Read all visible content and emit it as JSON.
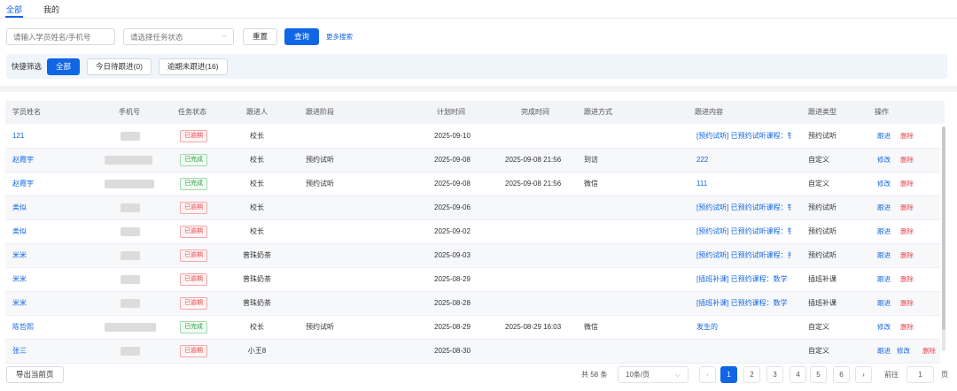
{
  "tabs": {
    "all": "全部",
    "mine": "我的"
  },
  "search": {
    "name_placeholder": "请输入学员姓名/手机号",
    "status_placeholder": "请选择任务状态",
    "reset": "重置",
    "query": "查询",
    "more": "更多搜索"
  },
  "quick": {
    "label": "快捷筛选",
    "all": "全部",
    "today": "今日待跟进(0)",
    "overdue": "逾期未跟进(16)"
  },
  "table": {
    "headers": {
      "name": "学员姓名",
      "phone": "手机号",
      "status": "任务状态",
      "owner": "跟进人",
      "stage": "跟进阶段",
      "plan": "计划时间",
      "finish": "完成时间",
      "method": "跟进方式",
      "content": "跟进内容",
      "type": "跟进类型",
      "ops": "操作"
    },
    "rows": [
      {
        "name": "121",
        "status": "已逾期",
        "owner": "校长",
        "stage": "",
        "plan": "2025-09-10",
        "finish": "",
        "method": "",
        "content": "[预约试听] 已预约试听课程：钅",
        "type": "预约试听",
        "ops": [
          "跟进",
          "删除"
        ]
      },
      {
        "name": "赵霞宇",
        "status": "已完成",
        "owner": "校长",
        "stage": "预约试听",
        "plan": "2025-09-08",
        "finish": "2025-09-08 21:56",
        "method": "到访",
        "content": "222",
        "type": "自定义",
        "ops": [
          "修改",
          "删除"
        ]
      },
      {
        "name": "赵霞宇",
        "status": "已完成",
        "owner": "校长",
        "stage": "预约试听",
        "plan": "2025-09-08",
        "finish": "2025-09-08 21:56",
        "method": "微信",
        "content": "111",
        "type": "自定义",
        "ops": [
          "修改",
          "删除"
        ]
      },
      {
        "name": "类似",
        "status": "已逾期",
        "owner": "校长",
        "stage": "",
        "plan": "2025-09-06",
        "finish": "",
        "method": "",
        "content": "[预约试听] 已预约试听课程：钅",
        "type": "预约试听",
        "ops": [
          "跟进",
          "删除"
        ]
      },
      {
        "name": "类似",
        "status": "已逾期",
        "owner": "校长",
        "stage": "",
        "plan": "2025-09-02",
        "finish": "",
        "method": "",
        "content": "[预约试听] 已预约试听课程：钅",
        "type": "预约试听",
        "ops": [
          "跟进",
          "删除"
        ]
      },
      {
        "name": "米米",
        "status": "已逾期",
        "owner": "普珠奶茶",
        "stage": "",
        "plan": "2025-09-03",
        "finish": "",
        "method": "",
        "content": "[预约试听] 已预约试听课程：扌",
        "type": "预约试听",
        "ops": [
          "跟进",
          "删除"
        ]
      },
      {
        "name": "米米",
        "status": "已逾期",
        "owner": "普珠奶茶",
        "stage": "",
        "plan": "2025-08-29",
        "finish": "",
        "method": "",
        "content": "[插班补课] 已预约课程：数学",
        "type": "插班补课",
        "ops": [
          "跟进",
          "删除"
        ]
      },
      {
        "name": "米米",
        "status": "已逾期",
        "owner": "普珠奶茶",
        "stage": "",
        "plan": "2025-08-28",
        "finish": "",
        "method": "",
        "content": "[插班补课] 已预约课程：数学",
        "type": "插班补课",
        "ops": [
          "跟进",
          "删除"
        ]
      },
      {
        "name": "陈哲熙",
        "status": "已完成",
        "owner": "校长",
        "stage": "预约试听",
        "plan": "2025-08-29",
        "finish": "2025-08-29 16:03",
        "method": "微信",
        "content": "发生的",
        "type": "自定义",
        "ops": [
          "修改",
          "删除"
        ]
      },
      {
        "name": "张三",
        "status": "已逾期",
        "owner": "小王8",
        "stage": "",
        "plan": "2025-08-30",
        "finish": "",
        "method": "",
        "content": "",
        "type": "自定义",
        "ops": [
          "跟进",
          "修改",
          "删除"
        ]
      }
    ]
  },
  "footer": {
    "export": "导出当前页",
    "total": "共 58 条",
    "page_size": "10条/页",
    "pages": [
      "1",
      "2",
      "3",
      "4",
      "5",
      "6"
    ],
    "current_page": "1",
    "goto_label": "前往",
    "goto_value": "1",
    "page_unit": "页"
  },
  "colors": {
    "primary": "#1166e6",
    "danger": "#e5484d",
    "success": "#2ba245"
  }
}
